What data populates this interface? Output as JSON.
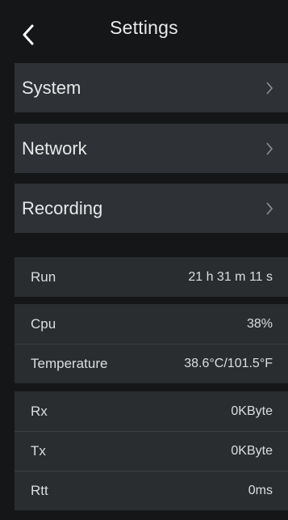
{
  "header": {
    "title": "Settings",
    "back_icon": "chevron-left-icon"
  },
  "menu": [
    {
      "label": "System",
      "icon": "chevron-right-icon"
    },
    {
      "label": "Network",
      "icon": "chevron-right-icon"
    },
    {
      "label": "Recording",
      "icon": "chevron-right-icon"
    }
  ],
  "status": {
    "run": {
      "label": "Run",
      "value": "21 h 31 m 11 s"
    },
    "cpu": {
      "label": "Cpu",
      "value": "38%"
    },
    "temperature": {
      "label": "Temperature",
      "value": "38.6°C/101.5°F"
    },
    "rx": {
      "label": "Rx",
      "value": "0KByte"
    },
    "tx": {
      "label": "Tx",
      "value": "0KByte"
    },
    "rtt": {
      "label": "Rtt",
      "value": "0ms"
    }
  },
  "colors": {
    "background": "#151617",
    "menu_bg": "#2e3135",
    "info_bg": "#2a2d30",
    "text": "#e6e7e8",
    "chevron": "#8b8e92"
  }
}
